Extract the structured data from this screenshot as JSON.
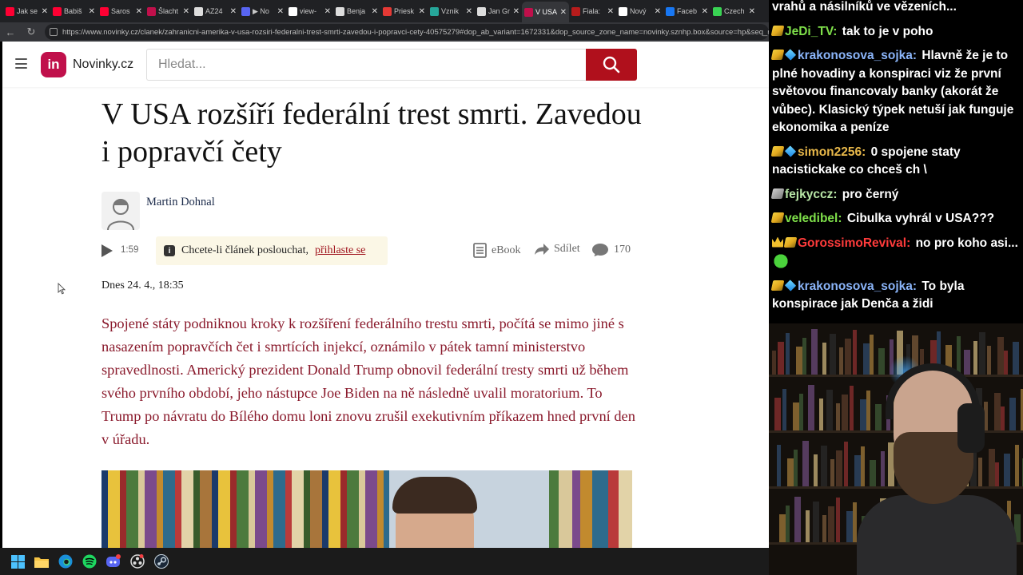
{
  "browser": {
    "tabs": [
      {
        "label": "Jak se",
        "favicon_color": "#ff0033",
        "active": false
      },
      {
        "label": "Babiš",
        "favicon_color": "#ff0033",
        "active": false
      },
      {
        "label": "Saros",
        "favicon_color": "#ff0033",
        "active": false
      },
      {
        "label": "Šlacht",
        "favicon_color": "#c0104b",
        "active": false
      },
      {
        "label": "AZ24",
        "favicon_color": "#dddddd",
        "active": false
      },
      {
        "label": "▶ No",
        "favicon_color": "#5865f2",
        "active": false
      },
      {
        "label": "view-",
        "favicon_color": "#ffffff",
        "active": false
      },
      {
        "label": "Benja",
        "favicon_color": "#dddddd",
        "active": false
      },
      {
        "label": "Priesk",
        "favicon_color": "#e53935",
        "active": false
      },
      {
        "label": "Vznik",
        "favicon_color": "#26a69a",
        "active": false
      },
      {
        "label": "Jan Gr",
        "favicon_color": "#dddddd",
        "active": false
      },
      {
        "label": "V USA",
        "favicon_color": "#c0104b",
        "active": true
      },
      {
        "label": "Fiala:",
        "favicon_color": "#b71c1c",
        "active": false
      },
      {
        "label": "Nový",
        "favicon_color": "#ffffff",
        "active": false
      },
      {
        "label": "Faceb",
        "favicon_color": "#1877f2",
        "active": false
      },
      {
        "label": "Czech",
        "favicon_color": "#39d353",
        "active": false
      }
    ],
    "url": "https://www.novinky.cz/clanek/zahranicni-amerika-v-usa-rozsiri-federalni-trest-smrti-zavedou-i-popravci-cety-40575279#dop_ab_variant=1672331&dop_source_zone_name=novinky.sznhp.box&source=hp&seq_no=1"
  },
  "site": {
    "logo_mark": "in",
    "logo_text": "Novinky.cz",
    "search_placeholder": "Hledat..."
  },
  "article": {
    "headline": "V USA rozšíří federální trest smrti. Zavedou i popravčí čety",
    "author": "Martin Dohnal",
    "audio_duration": "1:59",
    "listen_prompt": "Chcete-li článek poslouchat,",
    "listen_link": "přihlaste se",
    "ebook_label": "eBook",
    "share_label": "Sdílet",
    "comment_count": "170",
    "date": "Dnes 24. 4., 18:35",
    "perex": "Spojené státy podniknou kroky k rozšíření federálního trestu smrti, počítá se mimo jiné s nasazením popravčích čet i smrtících injekcí, oznámilo v pátek tamní ministerstvo spravedlnosti. Americký prezident Donald Trump obnovil federální tresty smrti už během svého prvního období, jeho nástupce Joe Biden na ně následně uvalil moratorium. To Trump po návratu do Bílého domu loni znovu zrušil exekutivním příkazem hned první den v úřadu."
  },
  "chat": {
    "messages": [
      {
        "badges": [],
        "user": "",
        "user_color": "#ffffff",
        "text": "vrahů a násilníků ve vězeních..."
      },
      {
        "badges": [
          "bits"
        ],
        "user": "JeDi_TV:",
        "user_color": "#7fe04a",
        "text": "tak to je v poho"
      },
      {
        "badges": [
          "bits",
          "gem"
        ],
        "user": "krakonosova_sojka:",
        "user_color": "#8ab4f8",
        "text": "Hlavně že je to plné hovadiny a konspiraci viz že první světovou financovaly banky (akorát že vůbec). Klasický týpek netuší jak funguje ekonomika a peníze"
      },
      {
        "badges": [
          "bits",
          "gem"
        ],
        "user": "simon2256:",
        "user_color": "#e8b84a",
        "text": "0 spojene staty nacistickake co chceš ch \\"
      },
      {
        "badges": [
          "grey"
        ],
        "user": "fejkyccz:",
        "user_color": "#b8e6a6",
        "text": "pro černý"
      },
      {
        "badges": [
          "bits"
        ],
        "user": "veledibel:",
        "user_color": "#7fe04a",
        "text": "Cibulka vyhrál v USA???"
      },
      {
        "badges": [
          "crown",
          "bits"
        ],
        "user": "GorossimoRevival:",
        "user_color": "#ff3b3b",
        "text": "no pro koho asi..."
      },
      {
        "badges": [
          "bits",
          "gem"
        ],
        "user": "krakonosova_sojka:",
        "user_color": "#8ab4f8",
        "text": "To byla konspirace jak Denča a židi"
      }
    ]
  },
  "taskbar": {
    "icons": [
      "windows-start-icon",
      "file-explorer-icon",
      "edge-browser-icon",
      "spotify-icon",
      "discord-icon",
      "obs-icon",
      "steam-icon"
    ]
  },
  "colors": {
    "brand": "#c0104b",
    "search_button": "#b0101c",
    "perex_text": "#8a1a2c",
    "link": "#a0131d"
  }
}
